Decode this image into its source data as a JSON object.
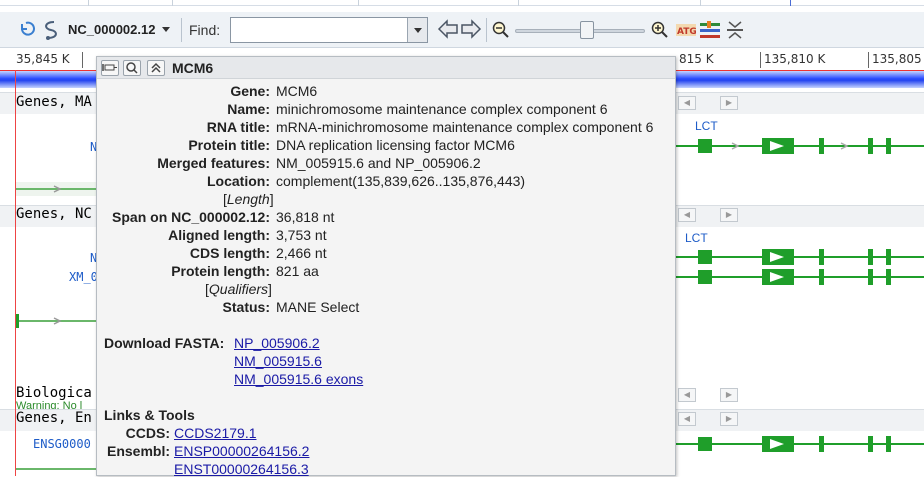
{
  "toolbar": {
    "accession": "NC_000002.12",
    "find_label": "Find:",
    "find_value": ""
  },
  "ruler": {
    "ticks": [
      "35,845 K",
      "815 K",
      "135,810 K",
      "135,805"
    ]
  },
  "tracks": {
    "genes_ma": "Genes, MA",
    "genes_nc": "Genes, NC",
    "biological": "Biologica",
    "genes_en": "Genes, En",
    "warning": "Warning: No l",
    "lct1": "LCT",
    "lct2": "LCT",
    "xm": "XM_0",
    "n1": "N",
    "n2": "N",
    "ensg": "ENSG0000"
  },
  "popup": {
    "title": "MCM6",
    "fields": [
      {
        "label": "Gene:",
        "value": "MCM6"
      },
      {
        "label": "Name:",
        "value": "minichromosome maintenance complex component 6"
      },
      {
        "label": "RNA title:",
        "value": "mRNA-minichromosome maintenance complex component 6"
      },
      {
        "label": "Protein title:",
        "value": "DNA replication licensing factor MCM6"
      },
      {
        "label": "Merged features:",
        "value": "NM_005915.6 and NP_005906.2"
      },
      {
        "label": "Location:",
        "value": "complement(135,839,626..135,876,443)"
      }
    ],
    "length_section": "Length",
    "length_fields": [
      {
        "label": "Span on NC_000002.12:",
        "value": "36,818 nt"
      },
      {
        "label": "Aligned length:",
        "value": "3,753 nt"
      },
      {
        "label": "CDS length:",
        "value": "2,466 nt"
      },
      {
        "label": "Protein length:",
        "value": "821 aa"
      }
    ],
    "qualifiers_section": "Qualifiers",
    "status_label": "Status:",
    "status_value": "MANE Select",
    "download_label": "Download FASTA:",
    "download_links": [
      "NP_005906.2",
      "NM_005915.6",
      "NM_005915.6 exons"
    ],
    "links_tools": "Links & Tools",
    "ccds_label": "CCDS:",
    "ccds_link": "CCDS2179.1",
    "ensembl_label": "Ensembl:",
    "ensembl_links": [
      "ENSP00000264156.2",
      "ENST00000264156.3"
    ]
  },
  "colors": {
    "gene_green": "#1f9e2a",
    "link_blue": "#1a1aa6"
  }
}
